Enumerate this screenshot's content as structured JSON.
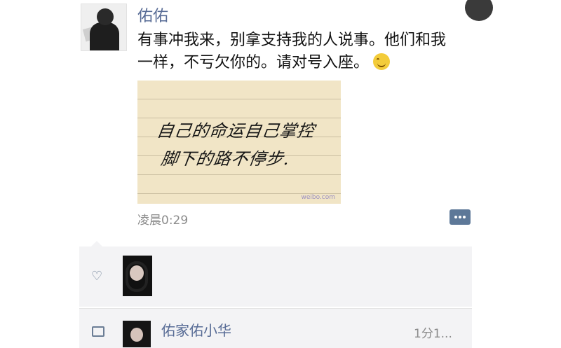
{
  "post": {
    "author": "佑佑",
    "text": "有事冲我来，别拿支持我的人说事。他们和我一样，不亏欠你的。请对号入座。",
    "emoji_icon": "smile-emoji-icon",
    "image": {
      "handwriting_line1": "自己的命运自己掌控",
      "handwriting_line2": "脚下的路不停步.",
      "watermark": "weibo.com"
    },
    "time": "凌晨0:29"
  },
  "likes": {
    "icon": "heart-icon"
  },
  "comments": {
    "icon": "comment-icon",
    "items": [
      {
        "author": "佑家佑小华",
        "time": "1分1..."
      }
    ]
  },
  "colors": {
    "link": "#576b95",
    "panel": "#f3f3f5",
    "comment_button": "#5d7898"
  }
}
